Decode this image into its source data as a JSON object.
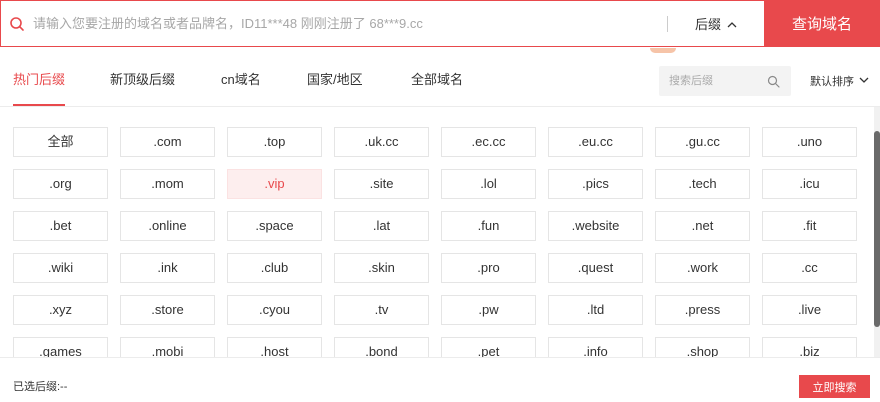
{
  "search": {
    "placeholder": "请输入您要注册的域名或者品牌名，ID11***48 刚刚注册了 68***9.cc",
    "value": "",
    "suffix_toggle_label": "后缀",
    "query_button_label": "查询域名"
  },
  "tabs": [
    {
      "label": "热门后缀",
      "active": true
    },
    {
      "label": "新顶级后缀",
      "active": false
    },
    {
      "label": "cn域名",
      "active": false
    },
    {
      "label": "国家/地区",
      "active": false
    },
    {
      "label": "全部域名",
      "active": false
    }
  ],
  "filter": {
    "placeholder": "搜索后缀"
  },
  "sort": {
    "label": "默认排序"
  },
  "suffixes": [
    "全部",
    ".com",
    ".top",
    ".uk.cc",
    ".ec.cc",
    ".eu.cc",
    ".gu.cc",
    ".uno",
    ".org",
    ".mom",
    ".vip",
    ".site",
    ".lol",
    ".pics",
    ".tech",
    ".icu",
    ".bet",
    ".online",
    ".space",
    ".lat",
    ".fun",
    ".website",
    ".net",
    ".fit",
    ".wiki",
    ".ink",
    ".club",
    ".skin",
    ".pro",
    ".quest",
    ".work",
    ".cc",
    ".xyz",
    ".store",
    ".cyou",
    ".tv",
    ".pw",
    ".ltd",
    ".press",
    ".live",
    ".games",
    ".mobi",
    ".host",
    ".bond",
    ".pet",
    ".info",
    ".shop",
    ".biz"
  ],
  "highlighted_suffix": ".vip",
  "footer": {
    "selected_label": "已选后缀:--",
    "search_button_label": "立即搜索"
  },
  "colors": {
    "accent": "#e8494c",
    "highlight_bg": "#fdeeee"
  },
  "icons": {
    "search": "search-icon",
    "chevron_up": "chevron-up-icon",
    "chevron_down": "chevron-down-icon"
  }
}
